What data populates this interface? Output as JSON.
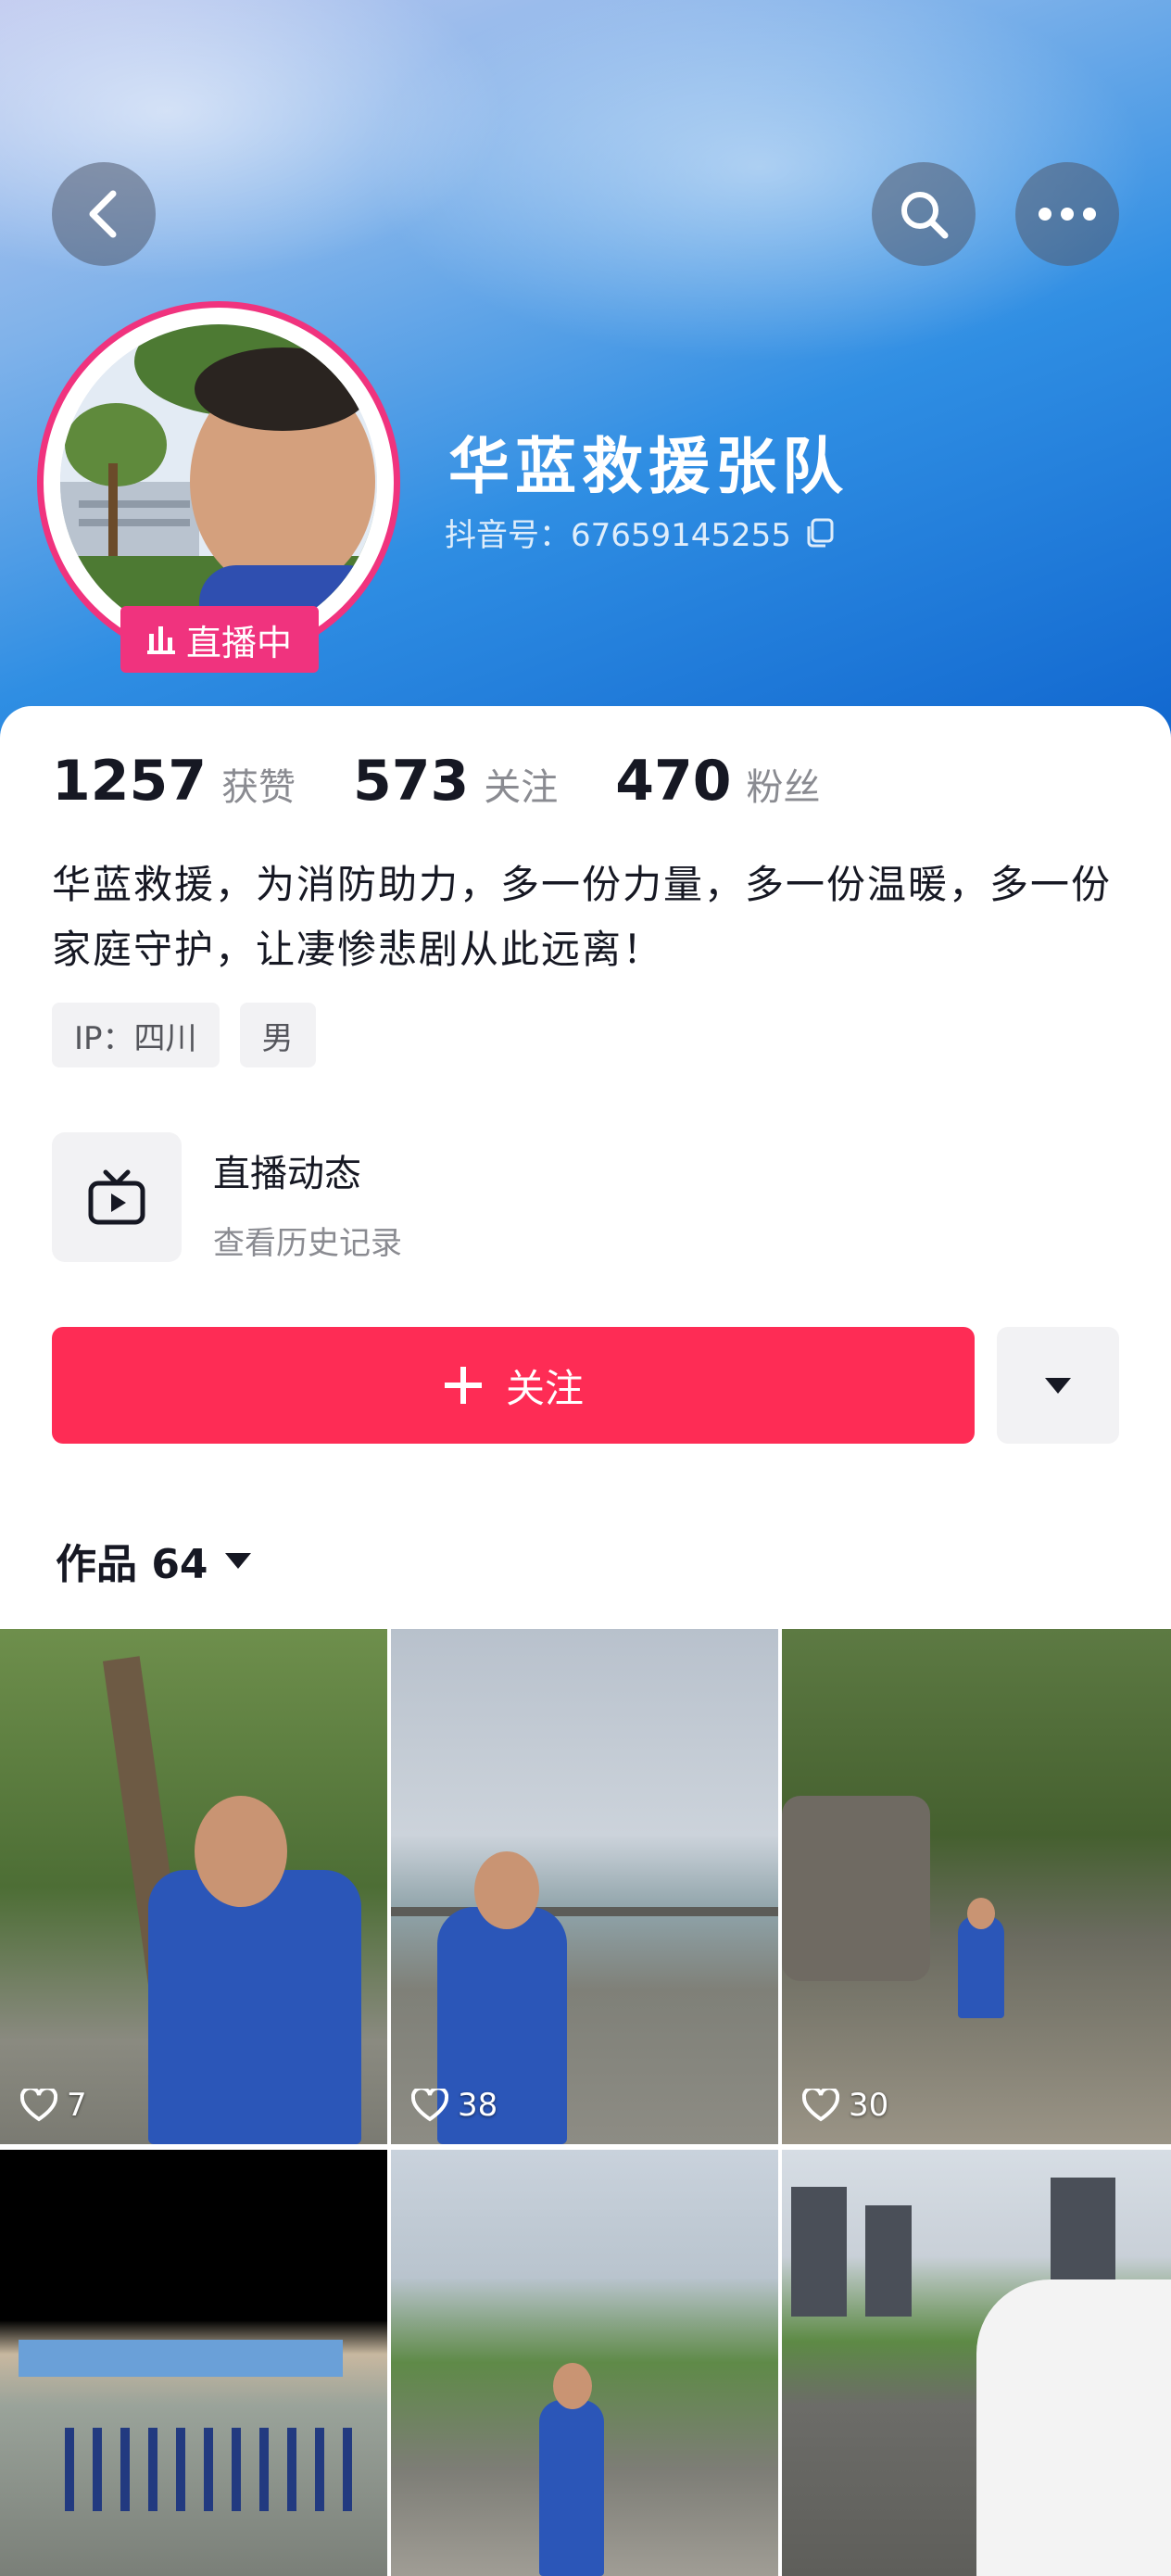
{
  "header": {
    "back_icon": "chevron-left-icon",
    "search_icon": "search-icon",
    "more_icon": "more-dots-icon"
  },
  "profile": {
    "name": "华蓝救援张队",
    "douyin_id": "抖音号：67659145255",
    "live_badge": "直播中"
  },
  "stats": [
    {
      "num": "1257",
      "label": "获赞"
    },
    {
      "num": "573",
      "label": "关注"
    },
    {
      "num": "470",
      "label": "粉丝"
    }
  ],
  "bio": "华蓝救援，为消防助力，多一份力量，多一份温暖，多一份家庭守护，让凄惨悲剧从此远离！",
  "tags": [
    "IP：四川",
    "男"
  ],
  "live_dynamic": {
    "title": "直播动态",
    "subtitle": "查看历史记录"
  },
  "follow_button": "关注",
  "works": {
    "label": "作品 64"
  },
  "videos": [
    {
      "likes": "7"
    },
    {
      "likes": "38"
    },
    {
      "likes": "30"
    },
    {
      "likes": ""
    },
    {
      "likes": ""
    },
    {
      "likes": ""
    }
  ],
  "colors": {
    "accent": "#fe2c55",
    "live_pink": "#f0337e",
    "banner_blue": "#1167cf"
  }
}
